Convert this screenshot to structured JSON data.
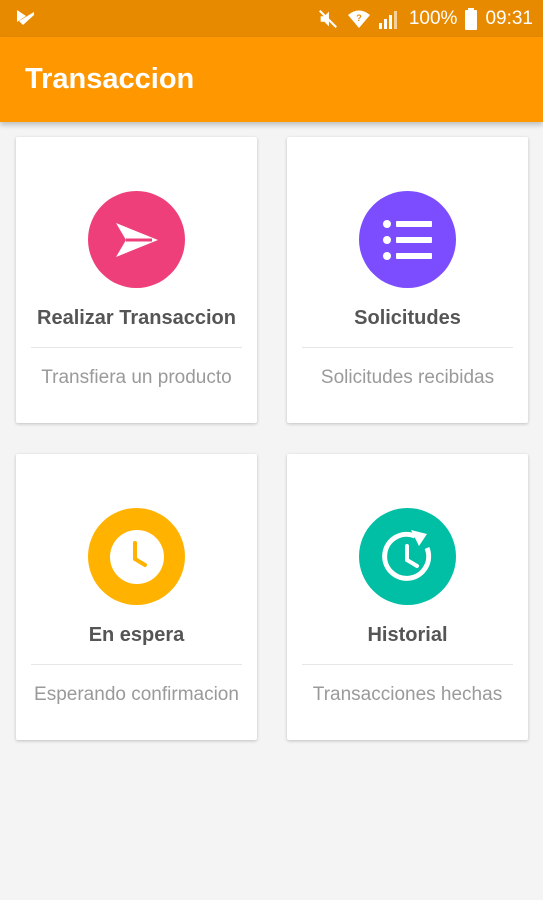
{
  "status_bar": {
    "battery_percent": "100%",
    "time": "09:31"
  },
  "app_bar": {
    "title": "Transaccion"
  },
  "cards": [
    {
      "title": "Realizar Transaccion",
      "subtitle": "Transfiera un producto",
      "icon": "send-icon",
      "color": "#ee3f7a"
    },
    {
      "title": "Solicitudes",
      "subtitle": "Solicitudes recibidas",
      "icon": "list-icon",
      "color": "#7c4dff"
    },
    {
      "title": "En espera",
      "subtitle": "Esperando confirmacion",
      "icon": "clock-icon",
      "color": "#ffb300"
    },
    {
      "title": "Historial",
      "subtitle": "Transacciones hechas",
      "icon": "history-icon",
      "color": "#00bfa5"
    }
  ]
}
